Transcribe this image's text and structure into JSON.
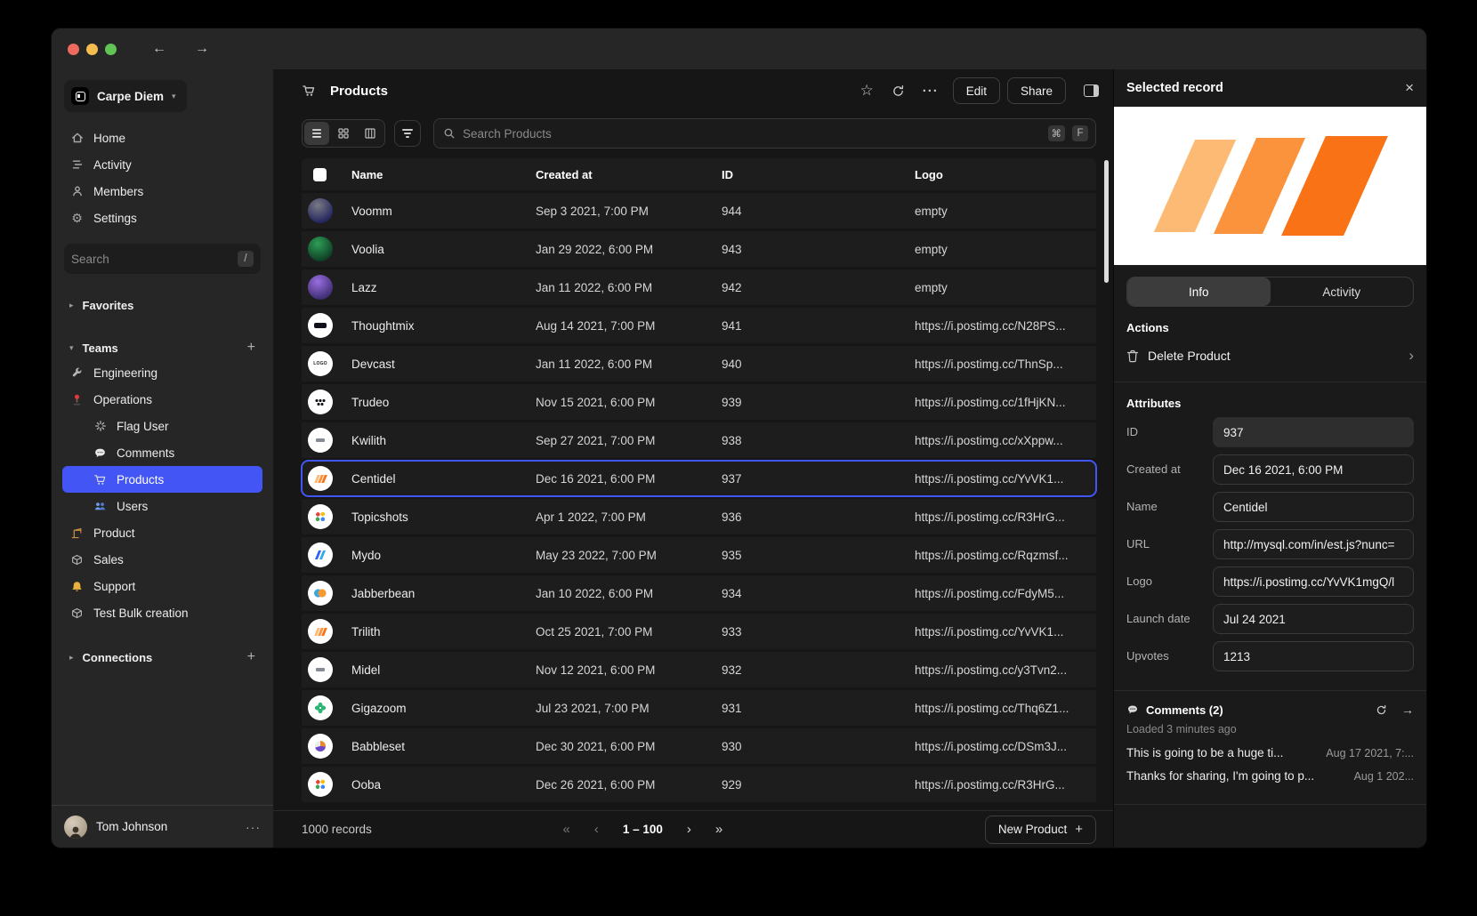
{
  "colors": {
    "accent": "#4355f4",
    "logo_stripes": [
      "#fdba74",
      "#fb923c",
      "#f97316"
    ]
  },
  "titlebar": {
    "back": "←",
    "forward": "→"
  },
  "sidebar": {
    "workspace": {
      "name": "Carpe Diem",
      "chevron": "▾"
    },
    "nav": [
      {
        "label": "Home"
      },
      {
        "label": "Activity"
      },
      {
        "label": "Members"
      },
      {
        "label": "Settings"
      }
    ],
    "search": {
      "placeholder": "Search",
      "shortcut": "/"
    },
    "favorites": {
      "label": "Favorites",
      "caret": "▸"
    },
    "teams": {
      "label": "Teams",
      "caret": "▾",
      "add": "+"
    },
    "team_items": [
      {
        "label": "Engineering"
      },
      {
        "label": "Operations"
      }
    ],
    "operations_children": [
      {
        "label": "Flag User"
      },
      {
        "label": "Comments"
      },
      {
        "label": "Products",
        "active": true
      },
      {
        "label": "Users"
      }
    ],
    "team_items_bottom": [
      {
        "label": "Product"
      },
      {
        "label": "Sales"
      },
      {
        "label": "Support"
      },
      {
        "label": "Test Bulk creation"
      }
    ],
    "connections": {
      "label": "Connections",
      "caret": "▸",
      "add": "+"
    },
    "user": {
      "name": "Tom Johnson",
      "menu": "···"
    }
  },
  "main": {
    "header": {
      "title": "Products",
      "star": "☆",
      "more": "···",
      "edit_label": "Edit",
      "share_label": "Share"
    },
    "search": {
      "placeholder": "Search Products",
      "keys": [
        "⌘",
        "F"
      ]
    },
    "table": {
      "columns": [
        "Name",
        "Created at",
        "ID",
        "Logo"
      ],
      "rows": [
        {
          "name": "Voomm",
          "created": "Sep 3 2021, 7:00 PM",
          "id": "944",
          "logo": "empty",
          "avatar": "grad-blue"
        },
        {
          "name": "Voolia",
          "created": "Jan 29 2022, 6:00 PM",
          "id": "943",
          "logo": "empty",
          "avatar": "grad-green"
        },
        {
          "name": "Lazz",
          "created": "Jan 11 2022, 6:00 PM",
          "id": "942",
          "logo": "empty",
          "avatar": "grad-purple"
        },
        {
          "name": "Thoughtmix",
          "created": "Aug 14 2021, 7:00 PM",
          "id": "941",
          "logo": "https://i.postimg.cc/N28PS...",
          "avatar": "pill"
        },
        {
          "name": "Devcast",
          "created": "Jan 11 2022, 6:00 PM",
          "id": "940",
          "logo": "https://i.postimg.cc/ThnSp...",
          "avatar": "logotext"
        },
        {
          "name": "Trudeo",
          "created": "Nov 15 2021, 6:00 PM",
          "id": "939",
          "logo": "https://i.postimg.cc/1fHjKN...",
          "avatar": "dots6"
        },
        {
          "name": "Kwilith",
          "created": "Sep 27 2021, 7:00 PM",
          "id": "938",
          "logo": "https://i.postimg.cc/xXppw...",
          "avatar": "mark"
        },
        {
          "name": "Centidel",
          "created": "Dec 16 2021, 6:00 PM",
          "id": "937",
          "logo": "https://i.postimg.cc/YvVK1...",
          "avatar": "stripes",
          "selected": true
        },
        {
          "name": "Topicshots",
          "created": "Apr 1 2022, 7:00 PM",
          "id": "936",
          "logo": "https://i.postimg.cc/R3HrG...",
          "avatar": "dots4"
        },
        {
          "name": "Mydo",
          "created": "May 23 2022, 7:00 PM",
          "id": "935",
          "logo": "https://i.postimg.cc/Rqzmsf...",
          "avatar": "slash"
        },
        {
          "name": "Jabberbean",
          "created": "Jan 10 2022, 6:00 PM",
          "id": "934",
          "logo": "https://i.postimg.cc/FdyM5...",
          "avatar": "circles"
        },
        {
          "name": "Trilith",
          "created": "Oct 25 2021, 7:00 PM",
          "id": "933",
          "logo": "https://i.postimg.cc/YvVK1...",
          "avatar": "stripes"
        },
        {
          "name": "Midel",
          "created": "Nov 12 2021, 6:00 PM",
          "id": "932",
          "logo": "https://i.postimg.cc/y3Tvn2...",
          "avatar": "mark"
        },
        {
          "name": "Gigazoom",
          "created": "Jul 23 2021, 7:00 PM",
          "id": "931",
          "logo": "https://i.postimg.cc/Thq6Z1...",
          "avatar": "clover"
        },
        {
          "name": "Babbleset",
          "created": "Dec 30 2021, 6:00 PM",
          "id": "930",
          "logo": "https://i.postimg.cc/DSm3J...",
          "avatar": "pie"
        },
        {
          "name": "Ooba",
          "created": "Dec 26 2021, 6:00 PM",
          "id": "929",
          "logo": "https://i.postimg.cc/R3HrG...",
          "avatar": "dots4"
        }
      ]
    },
    "footer": {
      "records": "1000 records",
      "pagination": {
        "first": "«",
        "prev": "‹",
        "label": "1 – 100",
        "next": "›",
        "last": "»"
      },
      "new_product_label": "New Product",
      "new_product_plus": "+"
    }
  },
  "panel": {
    "title": "Selected record",
    "close": "×",
    "tabs": [
      {
        "label": "Info",
        "active": true
      },
      {
        "label": "Activity",
        "active": false
      }
    ],
    "actions": {
      "label": "Actions",
      "delete_label": "Delete Product",
      "chevron": "›"
    },
    "attributes": {
      "label": "Attributes",
      "fields": [
        {
          "label": "ID",
          "value": "937",
          "filled": true
        },
        {
          "label": "Created at",
          "value": "Dec 16 2021, 6:00 PM"
        },
        {
          "label": "Name",
          "value": "Centidel"
        },
        {
          "label": "URL",
          "value": "http://mysql.com/in/est.js?nunc="
        },
        {
          "label": "Logo",
          "value": "https://i.postimg.cc/YvVK1mgQ/l"
        },
        {
          "label": "Launch date",
          "value": "Jul 24 2021"
        },
        {
          "label": "Upvotes",
          "value": "1213"
        }
      ]
    },
    "comments": {
      "title": "Comments (2)",
      "loaded": "Loaded 3 minutes ago",
      "arrow": "→",
      "items": [
        {
          "text": "This is going to be a huge ti...",
          "date": "Aug 17 2021, 7:..."
        },
        {
          "text": "Thanks for sharing, I'm going to p...",
          "date": "Aug 1 202..."
        }
      ]
    }
  }
}
